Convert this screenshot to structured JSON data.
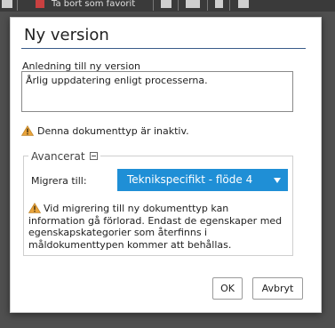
{
  "background": {
    "toolbar_text": "Ta bort som favorit"
  },
  "dialog": {
    "title": "Ny version",
    "reason": {
      "label": "Anledning till ny version",
      "value": "Årlig uppdatering enligt processerna."
    },
    "inactive_notice": "Denna dokumenttyp är inaktiv.",
    "advanced": {
      "legend": "Avancerat",
      "migrate_label": "Migrera till:",
      "migrate_selected": "Teknikspecifikt - flöde 4",
      "migrate_warning": "Vid migrering till ny dokumenttyp kan information gå förlorad. Endast de egenskaper med egenskapskategorier som återfinns i måldokumenttypen kommer att behållas."
    },
    "buttons": {
      "ok": "OK",
      "cancel": "Avbryt"
    }
  },
  "colors": {
    "accent": "#1f8fd6",
    "title_rule": "#3a5b8a",
    "warning": "#e8a33a",
    "overlay": "#4f4f4f"
  }
}
